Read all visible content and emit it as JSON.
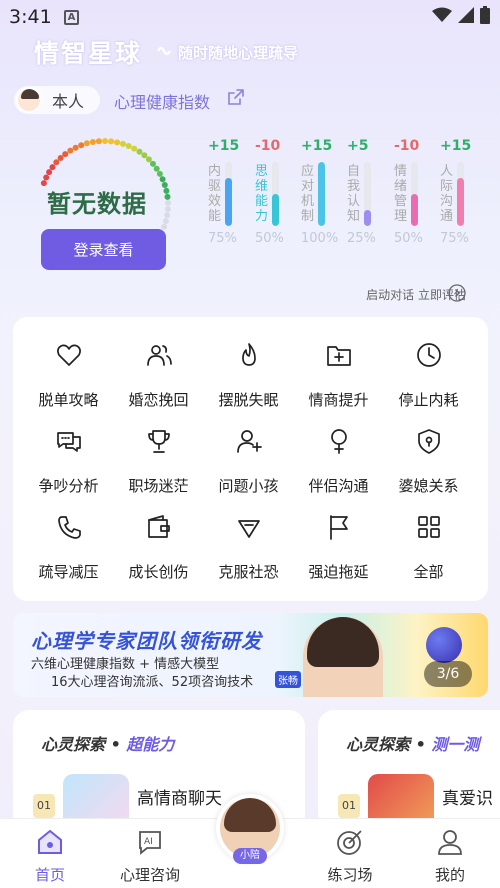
{
  "status_bar": {
    "time": "3:41",
    "notification_icon": "A"
  },
  "header": {
    "app_title": "情智星球",
    "slogan": "随时随地心理疏导"
  },
  "profile": {
    "self_label": "本人",
    "index_label": "心理健康指数"
  },
  "gauge": {
    "status_text": "暂无数据",
    "login_button": "登录查看"
  },
  "metrics": [
    {
      "delta": "+15",
      "name": "内驱效能",
      "percent": "75%",
      "value": 0.75,
      "color": "#4aa5f0",
      "highlight": false
    },
    {
      "delta": "-10",
      "name": "思维能力",
      "percent": "50%",
      "value": 0.5,
      "color": "#39c5d6",
      "highlight": true
    },
    {
      "delta": "+15",
      "name": "应对机制",
      "percent": "100%",
      "value": 1.0,
      "color": "#4dc3e8",
      "highlight": false
    },
    {
      "delta": "+5",
      "name": "自我认知",
      "percent": "25%",
      "value": 0.25,
      "color": "#9b8ef0",
      "highlight": false
    },
    {
      "delta": "-10",
      "name": "情绪管理",
      "percent": "50%",
      "value": 0.5,
      "color": "#e96bb2",
      "highlight": false
    },
    {
      "delta": "+15",
      "name": "人际沟通",
      "percent": "75%",
      "value": 0.75,
      "color": "#f07fb0",
      "highlight": false
    }
  ],
  "start_eval": "启动对话 立即评估",
  "features": [
    {
      "label": "脱单攻略",
      "icon": "heart-icon"
    },
    {
      "label": "婚恋挽回",
      "icon": "users-icon"
    },
    {
      "label": "摆脱失眠",
      "icon": "flame-icon"
    },
    {
      "label": "情商提升",
      "icon": "folder-plus-icon"
    },
    {
      "label": "停止内耗",
      "icon": "clock-icon"
    },
    {
      "label": "争吵分析",
      "icon": "chat-bubbles-icon"
    },
    {
      "label": "职场迷茫",
      "icon": "trophy-icon"
    },
    {
      "label": "问题小孩",
      "icon": "user-plus-icon"
    },
    {
      "label": "伴侣沟通",
      "icon": "female-icon"
    },
    {
      "label": "婆媳关系",
      "icon": "shield-icon"
    },
    {
      "label": "疏导减压",
      "icon": "phone-icon"
    },
    {
      "label": "成长创伤",
      "icon": "wallet-icon"
    },
    {
      "label": "克服社恐",
      "icon": "diamond-icon"
    },
    {
      "label": "强迫拖延",
      "icon": "flag-icon"
    },
    {
      "label": "全部",
      "icon": "grid-icon"
    }
  ],
  "banner": {
    "title": "心理学专家团队领衔研发",
    "line1": "六维心理健康指数 + 情感大模型",
    "line2": "16大心理咨询流派、52项咨询技术",
    "nameplate": "张畅",
    "pager": "3/6"
  },
  "explore_cards": [
    {
      "head": "心灵探索",
      "sub": "超能力",
      "rank": "01",
      "title": "高情商聊天"
    },
    {
      "head": "心灵探索",
      "sub": "测一测",
      "rank": "01",
      "title": "真爱识"
    }
  ],
  "bottom_nav": {
    "home": "首页",
    "consult": "心理咨询",
    "center_tag": "小陪",
    "practice": "练习场",
    "mine": "我的"
  },
  "colors": {
    "accent": "#6f5ce3",
    "positive": "#2fb06a",
    "negative": "#e46a6a"
  }
}
